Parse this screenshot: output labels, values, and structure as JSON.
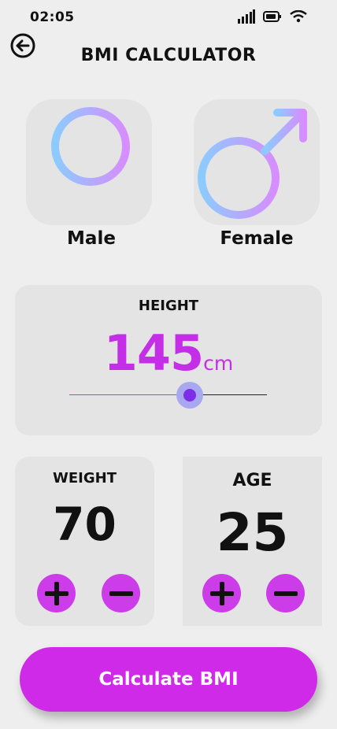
{
  "status_bar": {
    "time": "02:05"
  },
  "header": {
    "title": "BMI CALCULATOR"
  },
  "gender": {
    "options": [
      {
        "label": "Male",
        "icon": "venus-icon"
      },
      {
        "label": "Female",
        "icon": "mars-icon"
      }
    ]
  },
  "height": {
    "title": "HEIGHT",
    "value": "145",
    "unit": "cm",
    "slider_fraction": 0.61
  },
  "weight": {
    "title": "WEIGHT",
    "value": "70"
  },
  "age": {
    "title": "AGE",
    "value": "25"
  },
  "actions": {
    "calculate_label": "Calculate BMI"
  },
  "colors": {
    "accent": "#cc3ce8",
    "value_text": "#c42ee6",
    "card": "#e4e4e4",
    "background": "#eeeeee"
  }
}
